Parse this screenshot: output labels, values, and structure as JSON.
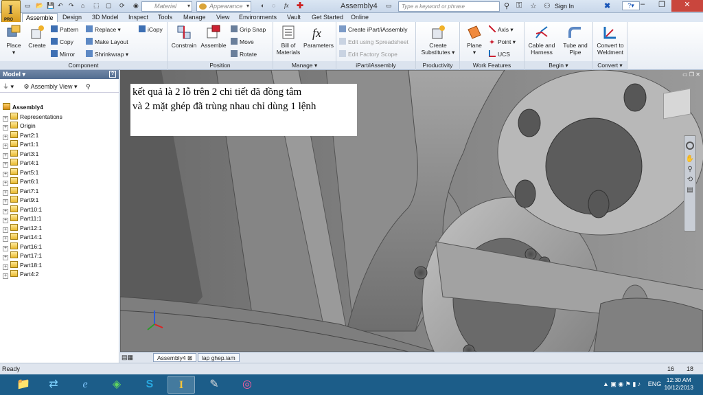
{
  "titlebar": {
    "document_title": "Assembly4",
    "material_placeholder": "Material",
    "appearance_placeholder": "Appearance",
    "search_placeholder": "Type a keyword or phrase",
    "sign_in": "Sign In",
    "help": "?"
  },
  "app_button": {
    "letter": "I",
    "edition": "PRO"
  },
  "tabs": [
    "Assemble",
    "Design",
    "3D Model",
    "Inspect",
    "Tools",
    "Manage",
    "View",
    "Environments",
    "Vault",
    "Get Started",
    "Online"
  ],
  "ribbon": {
    "component": {
      "label": "Component",
      "place": "Place",
      "create": "Create",
      "pattern": "Pattern",
      "copy": "Copy",
      "mirror": "Mirror",
      "replace": "Replace",
      "make_layout": "Make Layout",
      "shrinkwrap": "Shrinkwrap",
      "icopy": "iCopy"
    },
    "position": {
      "label": "Position",
      "constrain": "Constrain",
      "assemble": "Assemble",
      "grip_snap": "Grip Snap",
      "move": "Move",
      "rotate": "Rotate"
    },
    "manage": {
      "label": "Manage",
      "bom_line1": "Bill of",
      "bom_line2": "Materials",
      "parameters": "Parameters"
    },
    "ipart": {
      "label": "iPart/iAssembly",
      "create": "Create iPart/iAssembly",
      "edit_spreadsheet": "Edit using Spreadsheet",
      "edit_factory": "Edit Factory Scope"
    },
    "productivity": {
      "label": "Productivity",
      "line1": "Create",
      "line2": "Substitutes"
    },
    "work_features": {
      "label": "Work Features",
      "plane": "Plane",
      "axis": "Axis",
      "point": "Point",
      "ucs": "UCS"
    },
    "begin": {
      "label": "Begin",
      "cable_line1": "Cable and",
      "cable_line2": "Harness",
      "tube_line1": "Tube and",
      "tube_line2": "Pipe"
    },
    "convert": {
      "label": "Convert",
      "line1": "Convert to",
      "line2": "Weldment"
    }
  },
  "browser": {
    "title": "Model",
    "help": "?",
    "view": "Assembly View",
    "items": [
      {
        "label": "Assembly4",
        "kind": "root"
      },
      {
        "label": "Representations",
        "kind": "folder"
      },
      {
        "label": "Origin",
        "kind": "folder"
      },
      {
        "label": "Part2:1",
        "kind": "part"
      },
      {
        "label": "Part1:1",
        "kind": "part"
      },
      {
        "label": "Part3:1",
        "kind": "part"
      },
      {
        "label": "Part4:1",
        "kind": "part"
      },
      {
        "label": "Part5:1",
        "kind": "part"
      },
      {
        "label": "Part6:1",
        "kind": "part"
      },
      {
        "label": "Part7:1",
        "kind": "part"
      },
      {
        "label": "Part9:1",
        "kind": "part"
      },
      {
        "label": "Part10:1",
        "kind": "part"
      },
      {
        "label": "Part11:1",
        "kind": "part"
      },
      {
        "label": "Part12:1",
        "kind": "part"
      },
      {
        "label": "Part14:1",
        "kind": "part"
      },
      {
        "label": "Part16:1",
        "kind": "part"
      },
      {
        "label": "Part17:1",
        "kind": "part"
      },
      {
        "label": "Part18:1",
        "kind": "part"
      },
      {
        "label": "Part4:2",
        "kind": "part"
      }
    ]
  },
  "viewport": {
    "note_line1": "kết quả là 2 lỗ trên 2 chi tiết đã đồng tâm",
    "note_line2": "và 2 mặt ghép đã trùng nhau chỉ dùng 1 lệnh"
  },
  "doc_tabs": [
    "Assembly4",
    "lap ghep.iam"
  ],
  "status": {
    "text": "Ready",
    "count1": "16",
    "count2": "18"
  },
  "taskbar": {
    "lang": "ENG",
    "time": "12:30 AM",
    "date": "10/12/2013"
  },
  "colors": {
    "accent": "#f7c53a",
    "ribbon_blue": "#1b6fbd",
    "taskbar": "#1c5d89",
    "close_red": "#c9463d"
  }
}
